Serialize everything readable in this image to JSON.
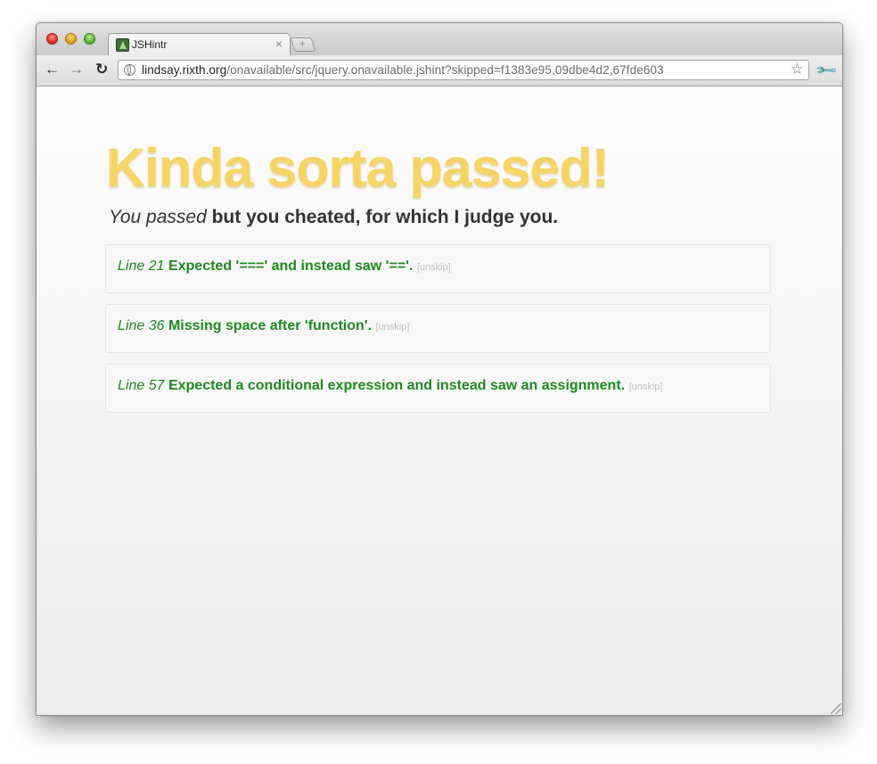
{
  "browser": {
    "tab_title": "JSHintr",
    "tab_close": "×",
    "new_tab": "+",
    "url_domain": "lindsay.rixth.org",
    "url_path": "/onavailable/src/jquery.onavailable.jshint?skipped=f1383e95,09dbe4d2,67fde603"
  },
  "page": {
    "headline": "Kinda sorta passed!",
    "subline_italic": "You passed",
    "subline_bold": " but you cheated, for which I judge you.",
    "headline_color": "#f6d466",
    "message_color": "#1e8a1e"
  },
  "skipped": [
    {
      "line": "Line 21",
      "message": "Expected '===' and instead saw '=='.",
      "action": "[unskip]"
    },
    {
      "line": "Line 36",
      "message": "Missing space after 'function'.",
      "action": "[unskip]"
    },
    {
      "line": "Line 57",
      "message": "Expected a conditional expression and instead saw an assignment.",
      "action": "[unskip]"
    }
  ]
}
